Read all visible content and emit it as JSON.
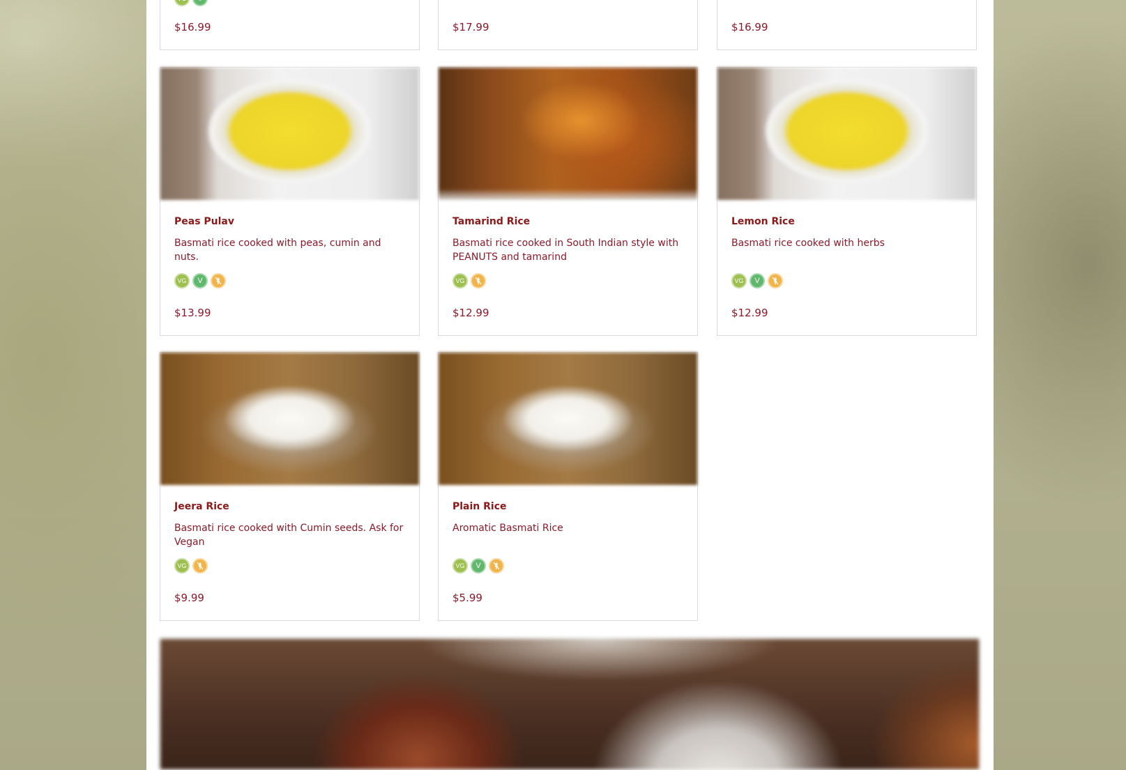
{
  "top_row_prices": [
    "$16.99",
    "$17.99",
    "$16.99"
  ],
  "menu_items": [
    {
      "name": "Peas Pulav",
      "description": "Basmati rice cooked with peas, cumin and nuts.",
      "price": "$13.99",
      "badges": [
        "vegan-icon",
        "vegetarian-icon",
        "gluten-free-icon"
      ],
      "image": "yellow-rice"
    },
    {
      "name": "Tamarind Rice",
      "description": "Basmati rice cooked in South Indian style with PEANUTS and tamarind",
      "price": "$12.99",
      "badges": [
        "vegan-icon",
        "gluten-free-icon"
      ],
      "image": "tamarind-rice"
    },
    {
      "name": "Lemon Rice",
      "description": "Basmati rice cooked with herbs",
      "price": "$12.99",
      "badges": [
        "vegan-icon",
        "vegetarian-icon",
        "gluten-free-icon"
      ],
      "image": "yellow-rice"
    },
    {
      "name": "Jeera Rice",
      "description": "Basmati rice cooked with Cumin seeds. Ask for Vegan",
      "price": "$9.99",
      "badges": [
        "vegan-icon",
        "gluten-free-icon"
      ],
      "image": "white-rice"
    },
    {
      "name": "Plain Rice",
      "description": "Aromatic Basmati Rice",
      "price": "$5.99",
      "badges": [
        "vegan-icon",
        "vegetarian-icon",
        "gluten-free-icon"
      ],
      "image": "white-rice"
    }
  ],
  "badge_labels": {
    "vegan": "VG",
    "vegetarian": "V"
  },
  "colors": {
    "title": "#8a1a1a",
    "text": "#8a1a2a",
    "vegan": "#9cbf4e",
    "vegetarian": "#5fb86b",
    "gluten_free": "#f0b44b"
  }
}
